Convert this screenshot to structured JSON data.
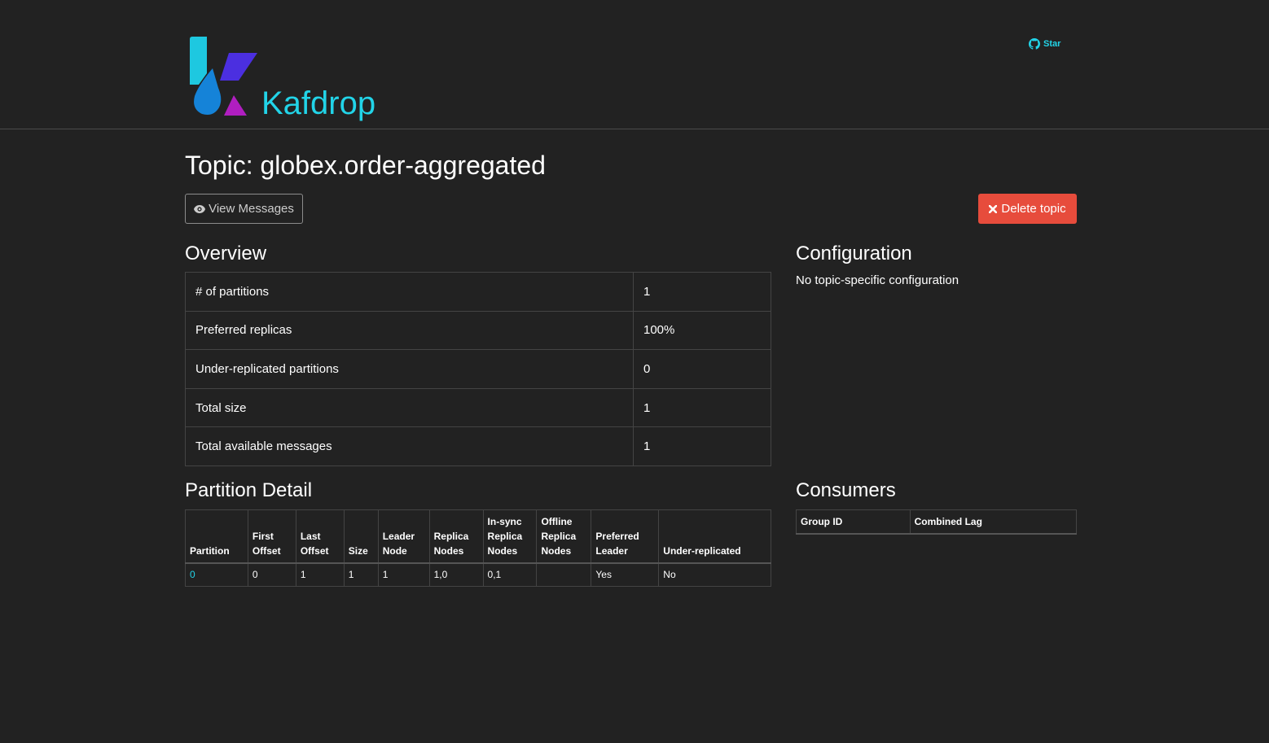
{
  "app": {
    "brand": "Kafdrop",
    "github_star_label": "Star",
    "colors": {
      "accent": "#22d4e8",
      "danger": "#e74c3c",
      "background": "#222222"
    }
  },
  "topic": {
    "title": "Topic: globex.order-aggregated",
    "view_messages_label": "View Messages",
    "delete_label": "Delete topic"
  },
  "overview": {
    "heading": "Overview",
    "rows": [
      {
        "label": "# of partitions",
        "value": "1"
      },
      {
        "label": "Preferred replicas",
        "value": "100%"
      },
      {
        "label": "Under-replicated partitions",
        "value": "0"
      },
      {
        "label": "Total size",
        "value": "1"
      },
      {
        "label": "Total available messages",
        "value": "1"
      }
    ]
  },
  "configuration": {
    "heading": "Configuration",
    "text": "No topic-specific configuration"
  },
  "partition_detail": {
    "heading": "Partition Detail",
    "columns": [
      [
        "Partition"
      ],
      [
        "First",
        "Offset"
      ],
      [
        "Last",
        "Offset"
      ],
      [
        "Size"
      ],
      [
        "Leader",
        "Node"
      ],
      [
        "Replica",
        "Nodes"
      ],
      [
        "In-sync",
        "Replica",
        "Nodes"
      ],
      [
        "Offline",
        "Replica",
        "Nodes"
      ],
      [
        "Preferred",
        "Leader"
      ],
      [
        "Under-replicated"
      ]
    ],
    "rows": [
      [
        "0",
        "0",
        "1",
        "1",
        "1",
        "1,0",
        "0,1",
        "",
        "Yes",
        "No"
      ]
    ]
  },
  "consumers": {
    "heading": "Consumers",
    "columns": [
      "Group ID",
      "Combined Lag"
    ]
  },
  "icons": {
    "logo": "kafdrop-logo",
    "github": "github-icon",
    "view": "eye-icon",
    "delete": "x-icon"
  }
}
